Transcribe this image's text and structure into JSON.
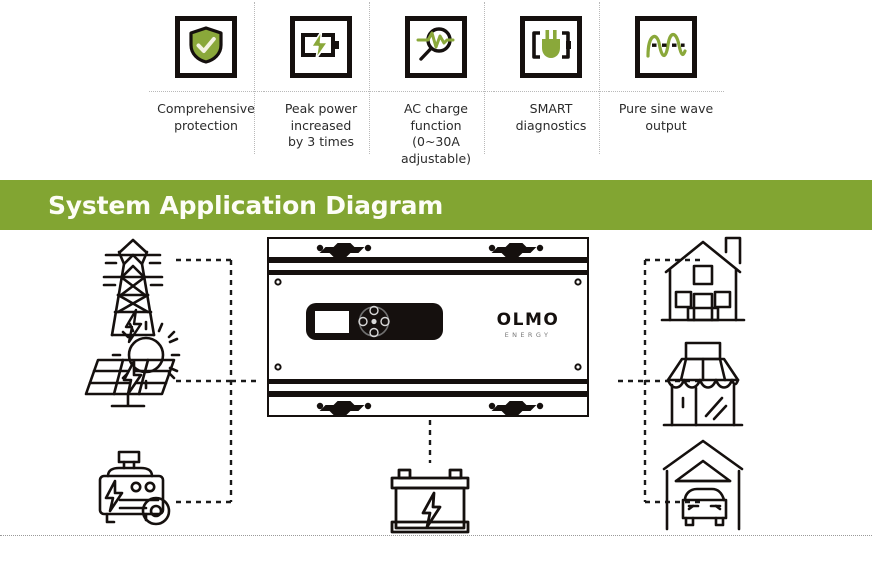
{
  "features": [
    {
      "icon": "shield-check-icon",
      "label": "Comprehensive\nprotection"
    },
    {
      "icon": "battery-bolt-icon",
      "label": "Peak power\nincreased\nby 3 times"
    },
    {
      "icon": "magnifier-wave-icon",
      "label": "AC charge\nfunction\n(0~30A\nadjustable)"
    },
    {
      "icon": "plug-socket-icon",
      "label": "SMART\ndiagnostics"
    },
    {
      "icon": "sine-wave-icon",
      "label": "Pure sine wave\noutput"
    }
  ],
  "banner": {
    "title": "System Application Diagram",
    "color": "#82a532"
  },
  "diagram": {
    "sources": [
      {
        "name": "power-grid-tower-icon",
        "label": ""
      },
      {
        "name": "solar-panel-sun-icon",
        "label": ""
      },
      {
        "name": "generator-icon",
        "label": ""
      }
    ],
    "device": {
      "name": "inverter-unit",
      "brand": "OLMO",
      "brand_sub": "ENERGY",
      "display": "",
      "buttons": 4
    },
    "storage": {
      "name": "battery-icon",
      "label": ""
    },
    "loads": [
      {
        "name": "house-icon",
        "label": ""
      },
      {
        "name": "shop-icon",
        "label": ""
      },
      {
        "name": "garage-car-icon",
        "label": ""
      }
    ]
  },
  "colors": {
    "green": "#82a532",
    "icon_green": "#8aa83a",
    "ink": "#15100e",
    "cream": "#f4f3e2",
    "text": "#2b2b2b",
    "dotted": "#b9b9b9"
  }
}
